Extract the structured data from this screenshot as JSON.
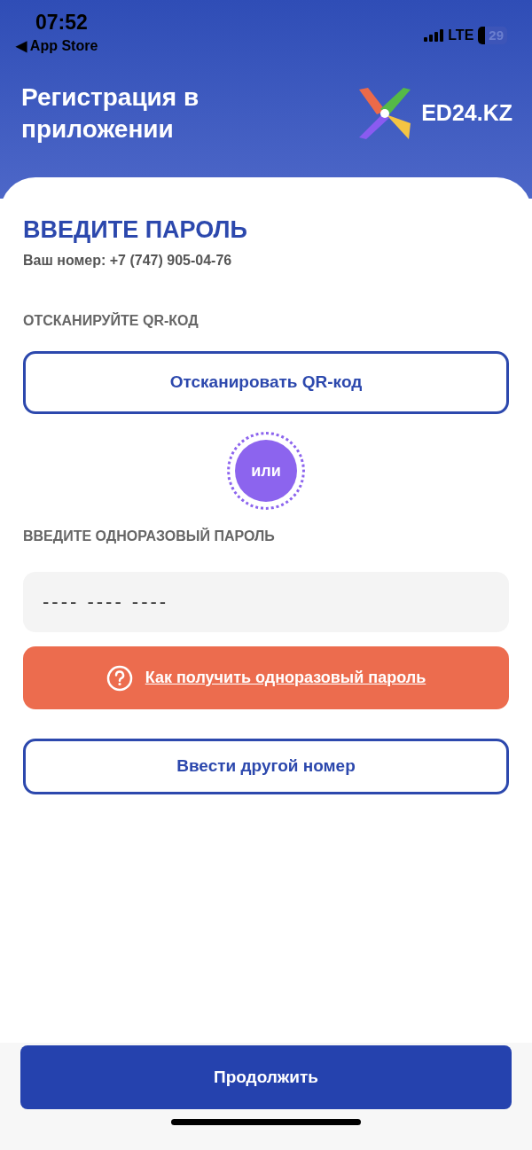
{
  "status_bar": {
    "time": "07:52",
    "back": "◀ App Store",
    "network": "LTE",
    "battery": "29"
  },
  "header": {
    "title": "Регистрация в приложении",
    "logo_text": "ED24.KZ"
  },
  "form": {
    "title": "ВВЕДИТЕ ПАРОЛЬ",
    "phone": "Ваш номер: +7 (747) 905-04-76",
    "qr_label": "ОТСКАНИРУЙТЕ QR-КОД",
    "qr_button": "Отсканировать QR-код",
    "or": "или",
    "otp_label": "ВВЕДИТЕ ОДНОРАЗОВЫЙ ПАРОЛЬ",
    "otp_placeholder": "---- ---- ----",
    "help_link": "Как получить одноразовый пароль",
    "other_number_button": "Ввести другой номер"
  },
  "continue_button": "Продолжить"
}
